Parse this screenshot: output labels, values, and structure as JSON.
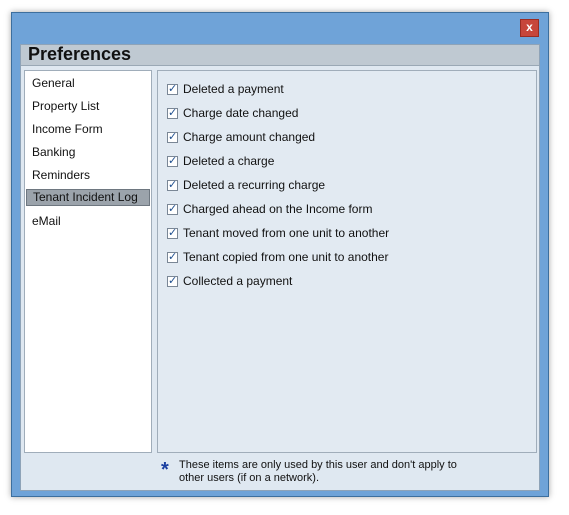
{
  "window": {
    "title": "Preferences",
    "close_glyph": "x"
  },
  "nav": {
    "items": [
      {
        "label": "General",
        "selected": false
      },
      {
        "label": "Property List",
        "selected": false
      },
      {
        "label": "Income Form",
        "selected": false
      },
      {
        "label": "Banking",
        "selected": false
      },
      {
        "label": "Reminders",
        "selected": false
      },
      {
        "label": "Tenant Incident Log",
        "selected": true
      },
      {
        "label": "eMail",
        "selected": false
      }
    ]
  },
  "incident_log": {
    "options": [
      {
        "label": "Deleted a payment",
        "checked": true
      },
      {
        "label": "Charge date changed",
        "checked": true
      },
      {
        "label": "Charge amount changed",
        "checked": true
      },
      {
        "label": "Deleted a charge",
        "checked": true
      },
      {
        "label": "Deleted a recurring charge",
        "checked": true
      },
      {
        "label": "Charged ahead on the Income form",
        "checked": true
      },
      {
        "label": "Tenant moved from one unit to another",
        "checked": true
      },
      {
        "label": "Tenant copied from one unit to another",
        "checked": true
      },
      {
        "label": "Collected a payment",
        "checked": true
      }
    ],
    "check_glyph": "✓"
  },
  "footnote": {
    "marker": "*",
    "text": "These items are only used by this user and don't apply to other users (if on a network)."
  },
  "colors": {
    "window_frame": "#6fa3d8",
    "header_bar": "#bfc9d2",
    "panel_bg": "#e2eaf2",
    "selected_nav": "#9ba3ab",
    "close_button": "#c7463b",
    "asterisk": "#1a3fa0"
  }
}
